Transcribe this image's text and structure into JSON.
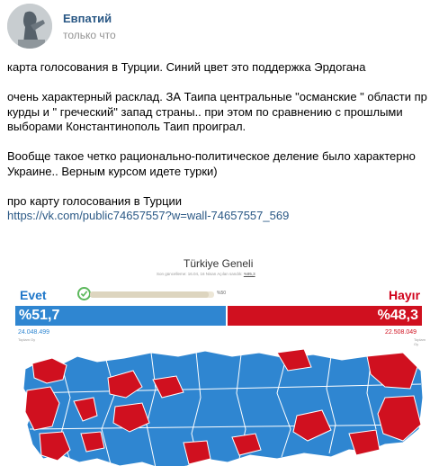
{
  "post": {
    "author": "Евпатий",
    "time": "только что",
    "lines": [
      "карта голосования в Турции. Синий цвет это поддержка Эрдогана",
      "",
      "очень характерный расклад. ЗА Таипа центральные \"османские \" области пр",
      "курды и \" греческий\" запад страны.. при этом по сравнению с прошлыми",
      "выборами Константинополь Таип проиграл.",
      "",
      "Вообще такое четко рационально-политическое деление было характерно",
      "Украине.. Верным курсом идете турки)",
      "",
      "про карту голосования в Турции"
    ],
    "link": "https://vk.com/public74657557?w=wall-74657557_569"
  },
  "attachment": {
    "title": "Türkiye Geneli",
    "subtitle": "Son güncelleme: 16.04, 16 Nisan   Açılan sandık:",
    "opened_pct": "%95,3",
    "threshold": "%50",
    "progress_fraction": 0.953,
    "yes_label": "Evet",
    "no_label": "Hayır",
    "yes_pct": "%51,7",
    "no_pct": "%48,3",
    "yes_share": 0.517,
    "yes_count": "24.048.499",
    "no_count": "22.508.049",
    "votes_caption": "Toplam Oy",
    "colors": {
      "yes": "#2f86d1",
      "no": "#d0101f",
      "link": "#2a5885"
    },
    "icons": {
      "check": "check-circle-icon"
    }
  }
}
